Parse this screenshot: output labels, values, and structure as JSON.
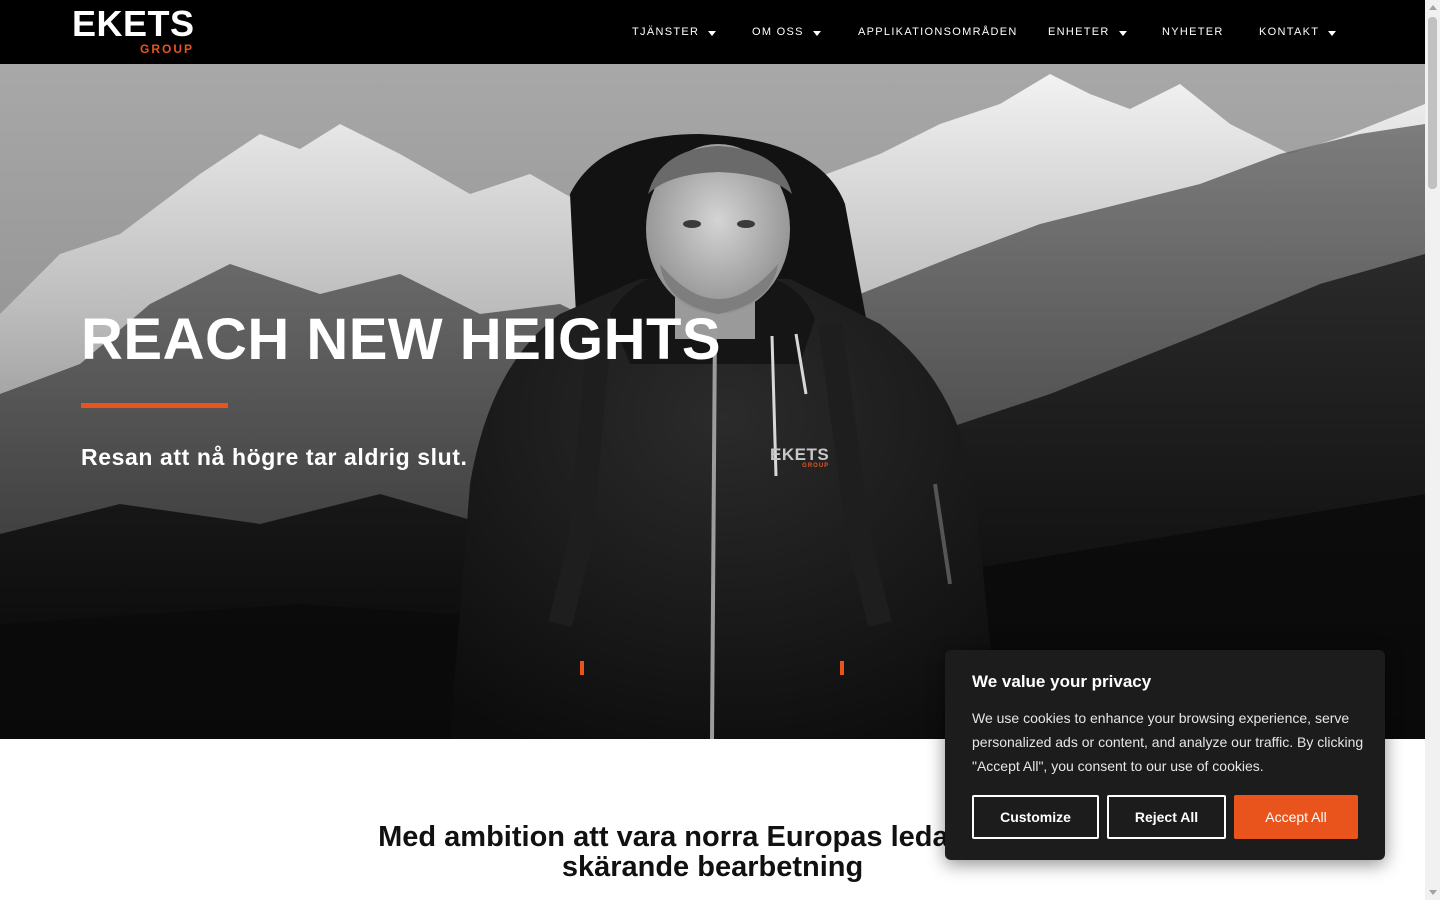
{
  "header": {
    "logo_word": "EKETS",
    "logo_sub": "GROUP",
    "nav": [
      {
        "label": "TJÄNSTER",
        "has_dropdown": true
      },
      {
        "label": "OM OSS",
        "has_dropdown": true
      },
      {
        "label": "APPLIKATIONSOMRÅDEN",
        "has_dropdown": false
      },
      {
        "label": "ENHETER",
        "has_dropdown": true
      },
      {
        "label": "NYHETER",
        "has_dropdown": false
      },
      {
        "label": "KONTAKT",
        "has_dropdown": true
      }
    ]
  },
  "hero": {
    "title": "REACH NEW HEIGHTS",
    "subtitle": "Resan att nå högre tar aldrig slut.",
    "jacket_logo_word": "EKETS",
    "jacket_logo_sub": "GROUP"
  },
  "section": {
    "heading_line1": "Med ambition att vara norra Europas ledande för",
    "heading_line2": "skärande bearbetning"
  },
  "cookie": {
    "title": "We value your privacy",
    "text": "We use cookies to enhance your browsing experience, serve personalized ads or content, and analyze our traffic. By clicking \"Accept All\", you consent to our use of cookies.",
    "customize_label": "Customize",
    "reject_label": "Reject All",
    "accept_label": "Accept All"
  },
  "colors": {
    "accent": "#e8541c",
    "header_bg": "#000000",
    "cookie_bg": "#1c1c1c"
  }
}
